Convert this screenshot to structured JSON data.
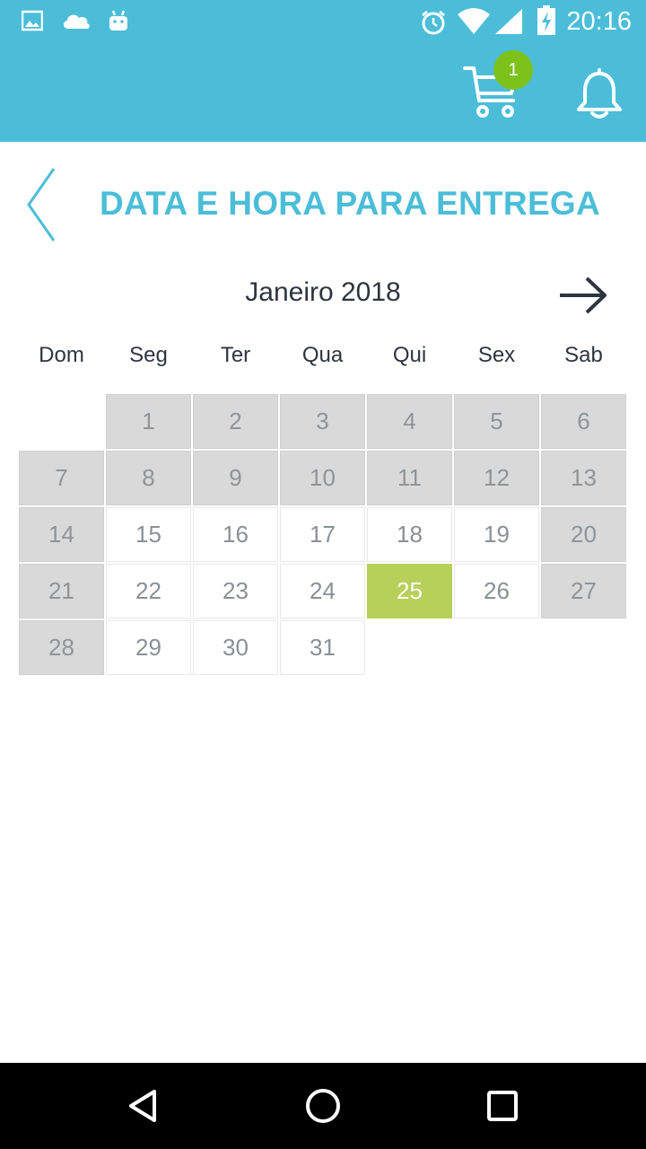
{
  "status_bar": {
    "time": "20:16",
    "icons_left": [
      "image-icon",
      "cloud-icon",
      "android-icon"
    ],
    "icons_right": [
      "alarm-icon",
      "wifi-icon",
      "signal-icon",
      "battery-charging-icon"
    ]
  },
  "app_bar": {
    "cart_badge": "1",
    "colors": {
      "bar": "#4bbdd8",
      "badge": "#7cc21b"
    }
  },
  "header": {
    "title": "DATA E HORA PARA ENTREGA"
  },
  "calendar": {
    "month_label": "Janeiro 2018",
    "weekdays": [
      "Dom",
      "Seg",
      "Ter",
      "Qua",
      "Qui",
      "Sex",
      "Sab"
    ],
    "selected_day": "25",
    "colors": {
      "disabled": "#d9d9d9",
      "selected": "#b7d05a"
    },
    "days": [
      {
        "label": "1",
        "state": "disabled"
      },
      {
        "label": "2",
        "state": "disabled"
      },
      {
        "label": "3",
        "state": "disabled"
      },
      {
        "label": "4",
        "state": "disabled"
      },
      {
        "label": "5",
        "state": "disabled"
      },
      {
        "label": "6",
        "state": "disabled"
      },
      {
        "label": "7",
        "state": "disabled"
      },
      {
        "label": "8",
        "state": "disabled"
      },
      {
        "label": "9",
        "state": "disabled"
      },
      {
        "label": "10",
        "state": "disabled"
      },
      {
        "label": "11",
        "state": "disabled"
      },
      {
        "label": "12",
        "state": "disabled"
      },
      {
        "label": "13",
        "state": "disabled"
      },
      {
        "label": "14",
        "state": "disabled"
      },
      {
        "label": "15",
        "state": "available"
      },
      {
        "label": "16",
        "state": "available"
      },
      {
        "label": "17",
        "state": "available"
      },
      {
        "label": "18",
        "state": "available"
      },
      {
        "label": "19",
        "state": "available"
      },
      {
        "label": "20",
        "state": "disabled"
      },
      {
        "label": "21",
        "state": "disabled"
      },
      {
        "label": "22",
        "state": "available"
      },
      {
        "label": "23",
        "state": "available"
      },
      {
        "label": "24",
        "state": "available"
      },
      {
        "label": "25",
        "state": "selected"
      },
      {
        "label": "26",
        "state": "available"
      },
      {
        "label": "27",
        "state": "disabled"
      },
      {
        "label": "28",
        "state": "disabled"
      },
      {
        "label": "29",
        "state": "available"
      },
      {
        "label": "30",
        "state": "available"
      },
      {
        "label": "31",
        "state": "available"
      }
    ]
  },
  "nav_bar": {
    "buttons": [
      "back-triangle-icon",
      "home-circle-icon",
      "recents-square-icon"
    ]
  }
}
